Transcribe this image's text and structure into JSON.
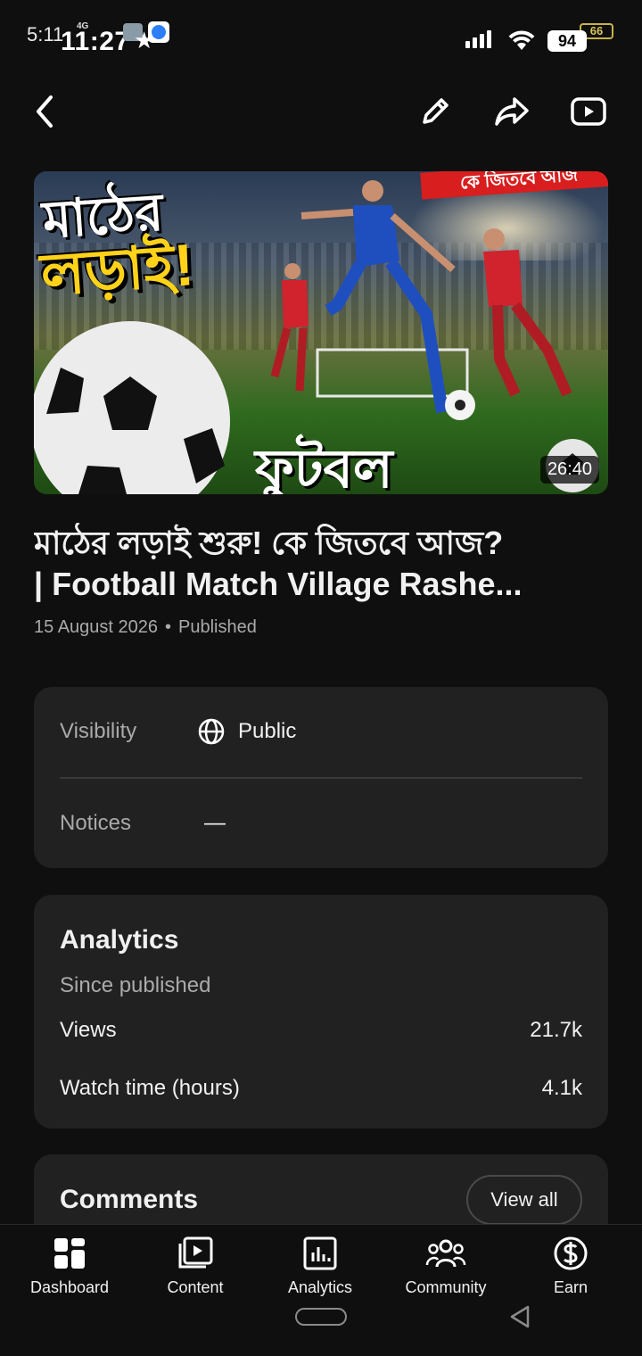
{
  "status_bar": {
    "time_back": "5:11",
    "network": "4G",
    "time": "11:27",
    "battery_back": "66",
    "battery": "94"
  },
  "toolbar": {
    "back_icon": "chevron-left-icon",
    "edit_icon": "pencil-icon",
    "share_icon": "share-arrow-icon",
    "watch_icon": "youtube-play-icon"
  },
  "video": {
    "thumbnail": {
      "text_top": "মাঠের",
      "text_middle": "লড়াই!",
      "text_bottom": "ফুটবল",
      "banner": "কে জিতবে আজ",
      "duration": "26:40"
    },
    "title_line1": "মাঠের লড়াই শুরু! কে জিতবে আজ?",
    "title_line2": "| Football Match Village Rashe...",
    "date": "15 August 2026",
    "separator": "•",
    "status": "Published"
  },
  "visibility_card": {
    "visibility_label": "Visibility",
    "visibility_value": "Public",
    "visibility_icon": "globe-icon",
    "notices_label": "Notices",
    "notices_value": "—"
  },
  "analytics_card": {
    "title": "Analytics",
    "subtitle": "Since published",
    "rows": [
      {
        "label": "Views",
        "value": "21.7k"
      },
      {
        "label": "Watch time (hours)",
        "value": "4.1k"
      }
    ]
  },
  "comments_card": {
    "title": "Comments",
    "view_all": "View all"
  },
  "bottom_nav": {
    "items": [
      {
        "label": "Dashboard",
        "icon": "dashboard-icon"
      },
      {
        "label": "Content",
        "icon": "content-icon"
      },
      {
        "label": "Analytics",
        "icon": "analytics-icon"
      },
      {
        "label": "Community",
        "icon": "community-icon"
      },
      {
        "label": "Earn",
        "icon": "earn-icon"
      }
    ]
  },
  "colors": {
    "background": "#0f0f0f",
    "card": "#212121",
    "secondary_text": "#aaaaaa",
    "primary_text": "#f1f1f1"
  }
}
